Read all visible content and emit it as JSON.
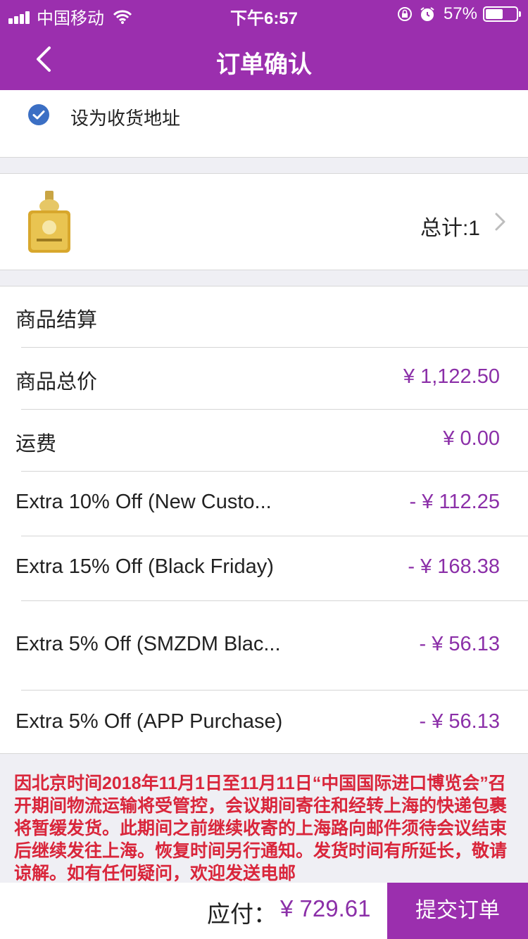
{
  "status_bar": {
    "carrier": "中国移动",
    "time": "下午6:57",
    "battery": "57%",
    "battery_level": 0.57
  },
  "nav": {
    "title": "订单确认",
    "back_icon": "chevron-left-icon"
  },
  "address": {
    "checkbox_checked": true,
    "label": "设为收货地址"
  },
  "product": {
    "total_label": "总计:1"
  },
  "settlement": {
    "header": "商品结算",
    "rows": [
      {
        "name": "商品总价",
        "value": "¥ 1,122.50"
      },
      {
        "name": "运费",
        "value": "¥ 0.00"
      },
      {
        "name": "Extra 10% Off (New Custo...",
        "value": "- ¥ 112.25"
      },
      {
        "name": "Extra 15% Off (Black Friday)",
        "value": "- ¥ 168.38"
      },
      {
        "name": "Extra 5% Off (SMZDM Blac...",
        "value": "- ¥ 56.13"
      },
      {
        "name": "Extra 5% Off (APP Purchase)",
        "value": "- ¥ 56.13"
      }
    ]
  },
  "notice": {
    "text": "因北京时间2018年11月1日至11月11日“中国国际进口博览会”召开期间物流运输将受管控，会议期间寄往和经转上海的快递包裹将暂缓发货。此期间之前继续收寄的上海路向邮件须待会议结束后继续发往上海。恢复时间另行通知。发货时间有所延长，敬请谅解。如有任何疑问，欢迎发送电邮"
  },
  "bottom": {
    "pay_label": "应付：",
    "pay_amount": "¥ 729.61",
    "submit_label": "提交订单"
  },
  "colors": {
    "brand_purple": "#9b2fae",
    "price_purple": "#8b2fa8",
    "notice_red": "#d9263b",
    "check_blue": "#3b6fc4"
  }
}
